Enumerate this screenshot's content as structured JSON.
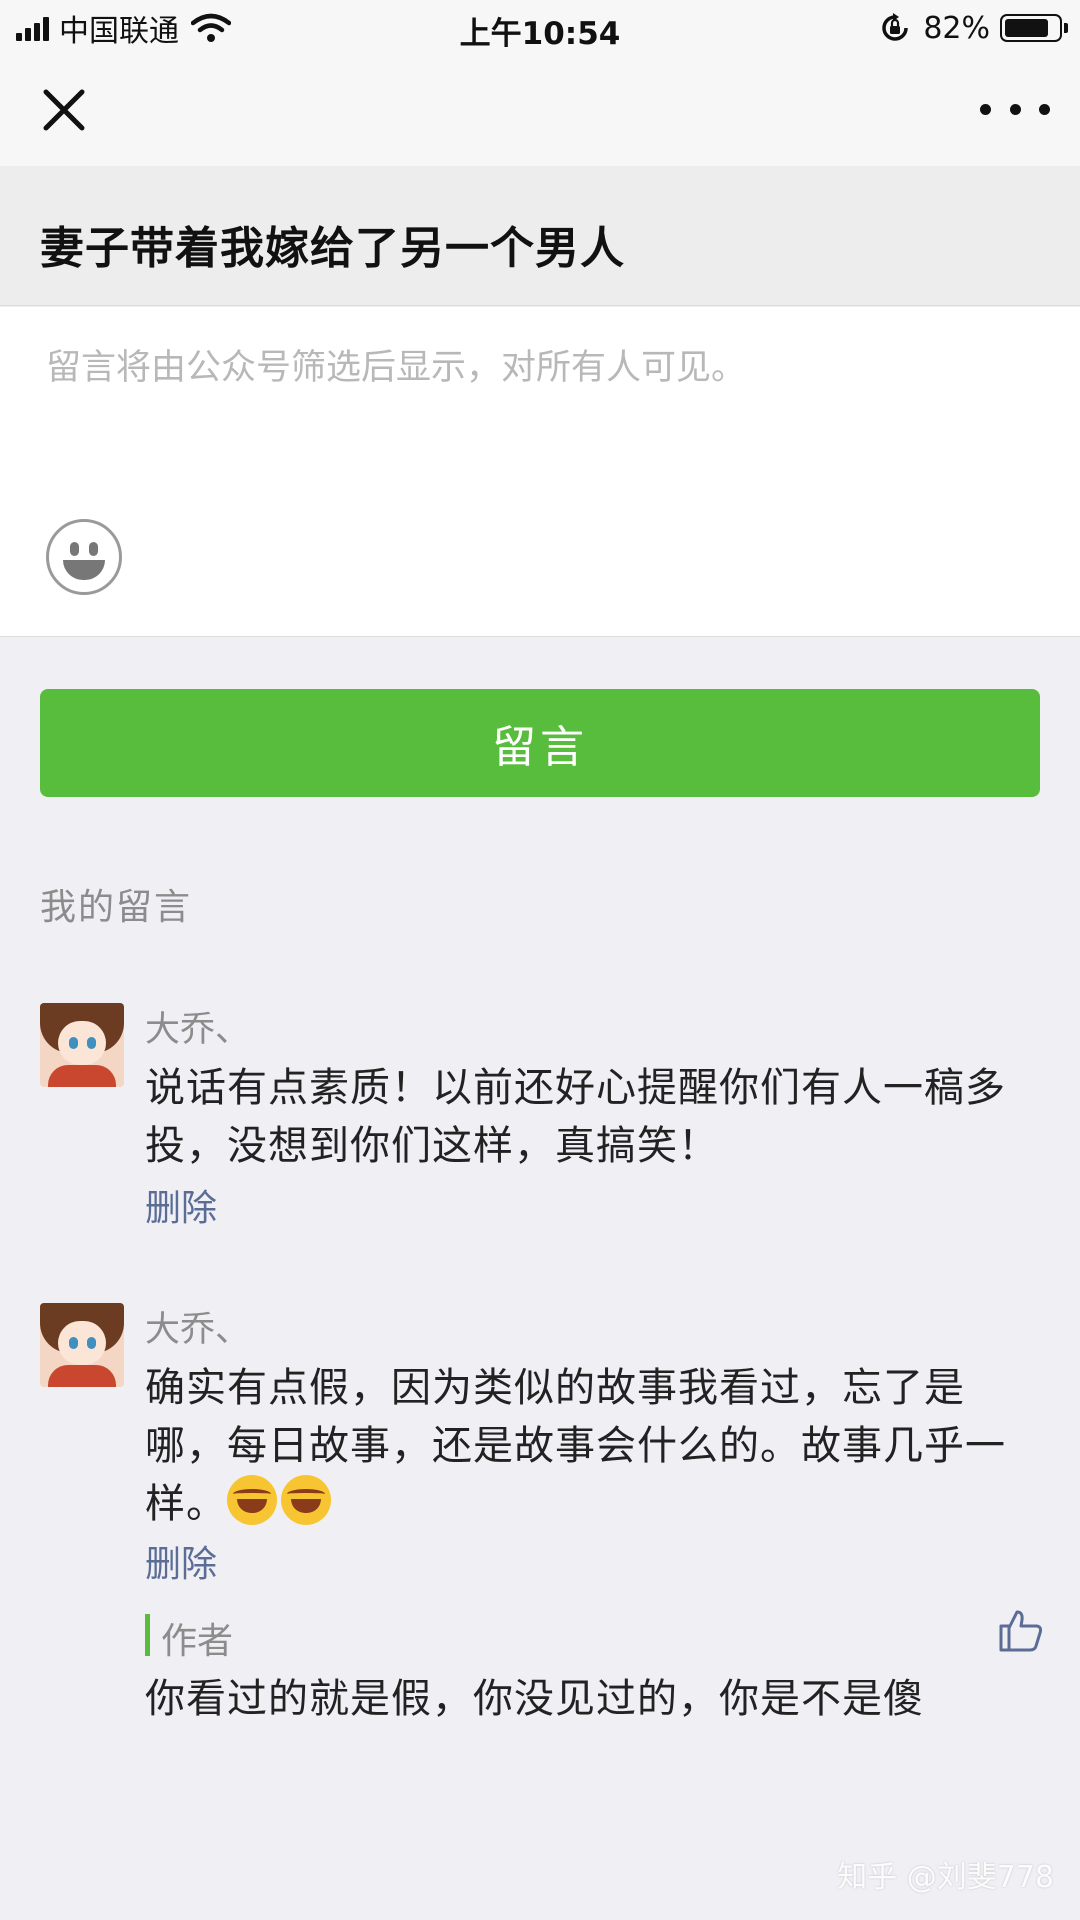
{
  "status_bar": {
    "carrier": "中国联通",
    "time": "上午10:54",
    "battery": "82%",
    "battery_level": 0.82
  },
  "nav": {
    "close_icon": "close-icon",
    "more_icon": "more-icon"
  },
  "article": {
    "title": "妻子带着我嫁给了另一个男人"
  },
  "comment_input": {
    "placeholder": "留言将由公众号筛选后显示，对所有人可见。",
    "emoji_icon": "emoji-icon"
  },
  "submit": {
    "label": "留言",
    "color": "#58bd3c"
  },
  "my_comments": {
    "label": "我的留言",
    "items": [
      {
        "name": "大乔、",
        "text": "说话有点素质！以前还好心提醒你们有人一稿多投，没想到你们这样，真搞笑！",
        "delete": "删除"
      },
      {
        "name": "大乔、",
        "text": "确实有点假，因为类似的故事我看过，忘了是哪，每日故事，还是故事会什么的。故事几乎一样。",
        "emoji": "laugh-cry-emoji",
        "delete": "删除",
        "reply": {
          "label": "作者",
          "text": "你看过的就是假，你没见过的，你是不是傻",
          "like_icon": "thumbs-up-icon"
        }
      }
    ]
  },
  "watermark": "知乎 @刘斐778"
}
